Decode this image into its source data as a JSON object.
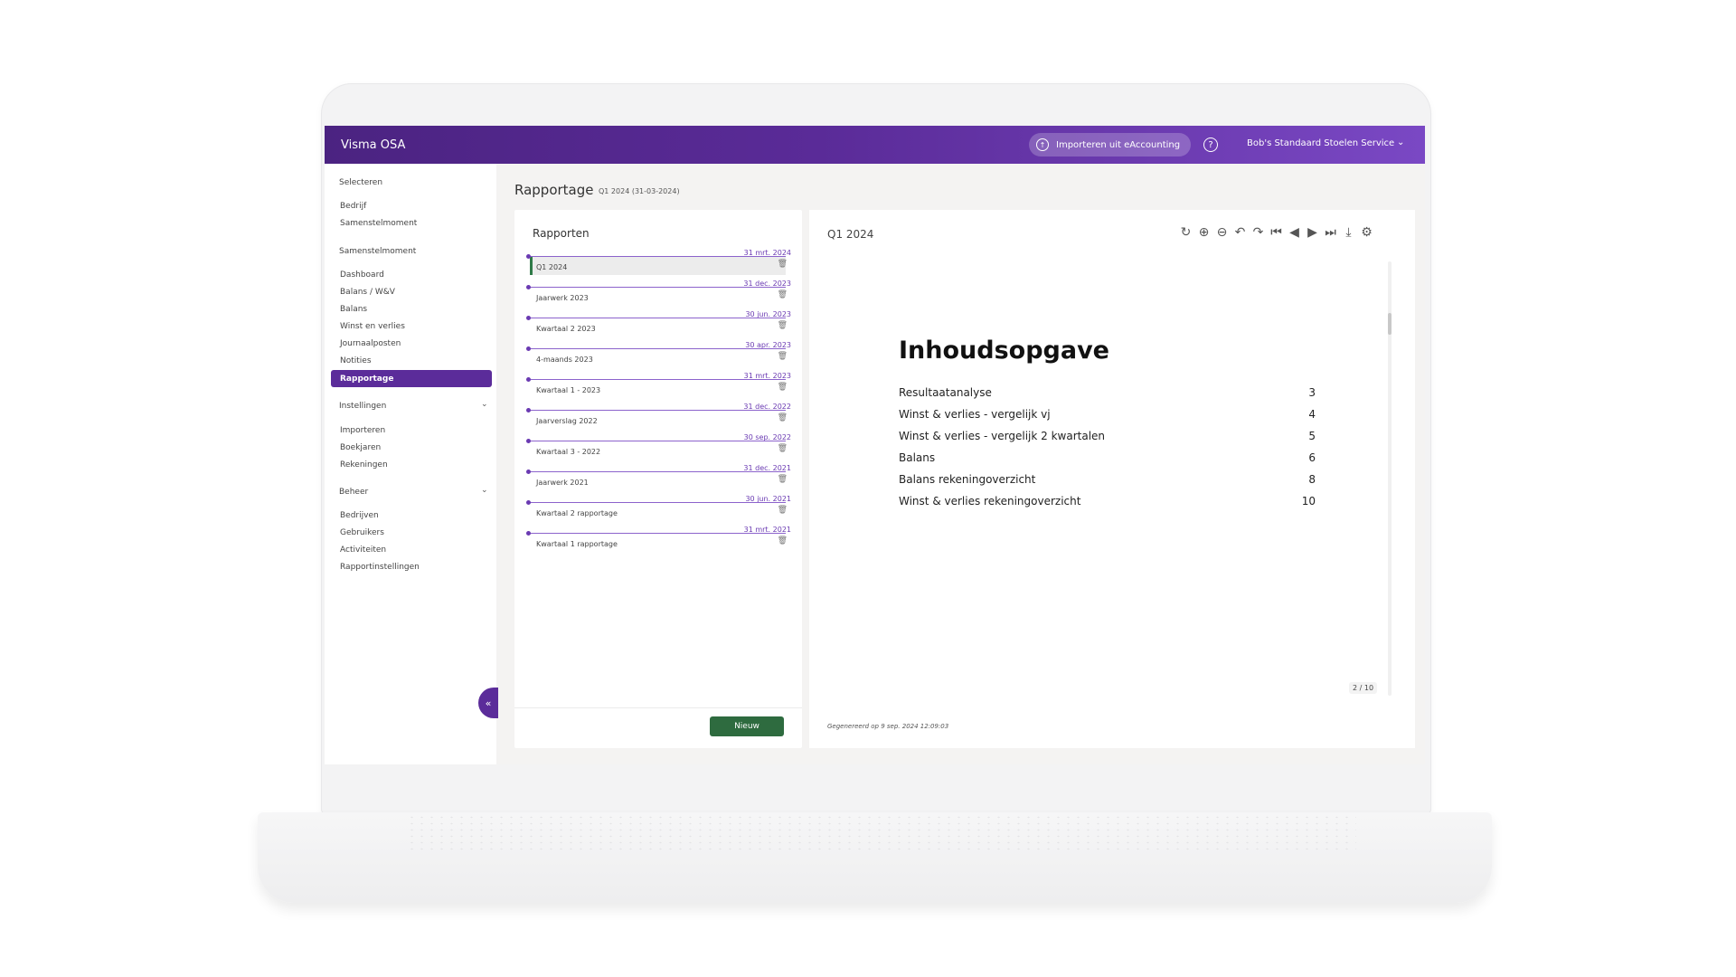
{
  "app": {
    "title": "Visma OSA"
  },
  "topbar": {
    "import_label": "Importeren uit eAccounting",
    "company_name": "Bob's Standaard Stoelen Service"
  },
  "sidebar": {
    "section_select": "Selecteren",
    "select_items": [
      "Bedrijf",
      "Samenstelmoment"
    ],
    "section_moment": "Samenstelmoment",
    "moment_items": [
      "Dashboard",
      "Balans / W&V",
      "Balans",
      "Winst en verlies",
      "Journaalposten",
      "Notities"
    ],
    "active_item": "Rapportage",
    "section_settings": "Instellingen",
    "settings_items": [
      "Importeren",
      "Boekjaren",
      "Rekeningen"
    ],
    "section_manage": "Beheer",
    "manage_items": [
      "Bedrijven",
      "Gebruikers",
      "Activiteiten",
      "Rapportinstellingen"
    ]
  },
  "page": {
    "title": "Rapportage",
    "subtitle": "Q1 2024 (31-03-2024)"
  },
  "reports": {
    "title": "Rapporten",
    "new_button": "Nieuw",
    "items": [
      {
        "date": "31 mrt. 2024",
        "name": "Q1 2024",
        "selected": true
      },
      {
        "date": "31 dec. 2023",
        "name": "Jaarwerk 2023"
      },
      {
        "date": "30 jun. 2023",
        "name": "Kwartaal 2 2023"
      },
      {
        "date": "30 apr. 2023",
        "name": "4-maands 2023"
      },
      {
        "date": "31 mrt. 2023",
        "name": "Kwartaal 1 - 2023"
      },
      {
        "date": "31 dec. 2022",
        "name": "Jaarverslag 2022"
      },
      {
        "date": "30 sep. 2022",
        "name": "Kwartaal 3 - 2022"
      },
      {
        "date": "31 dec. 2021",
        "name": "Jaarwerk 2021"
      },
      {
        "date": "30 jun. 2021",
        "name": "Kwartaal 2 rapportage"
      },
      {
        "date": "31 mrt. 2021",
        "name": "Kwartaal 1 rapportage"
      }
    ]
  },
  "viewer": {
    "title": "Q1 2024",
    "toolbar_icons": [
      "refresh-icon",
      "zoom-in-icon",
      "zoom-out-icon",
      "rotate-left-icon",
      "rotate-right-icon",
      "first-page-icon",
      "previous-page-icon",
      "next-page-icon",
      "last-page-icon",
      "download-icon",
      "document-settings-icon"
    ],
    "document": {
      "heading": "Inhoudsopgave",
      "toc": [
        {
          "label": "Resultaatanalyse",
          "page": "3"
        },
        {
          "label": "Winst & verlies - vergelijk vj",
          "page": "4"
        },
        {
          "label": "Winst & verlies - vergelijk 2 kwartalen",
          "page": "5"
        },
        {
          "label": "Balans",
          "page": "6"
        },
        {
          "label": "Balans rekeningoverzicht",
          "page": "8"
        },
        {
          "label": "Winst & verlies rekeningoverzicht",
          "page": "10"
        }
      ]
    },
    "page_counter": "2 / 10",
    "generated": "Gegenereerd op 9 sep. 2024 12:09:03"
  },
  "colors": {
    "brand": "#5b2c9a",
    "accent_green": "#2e6b3f"
  }
}
